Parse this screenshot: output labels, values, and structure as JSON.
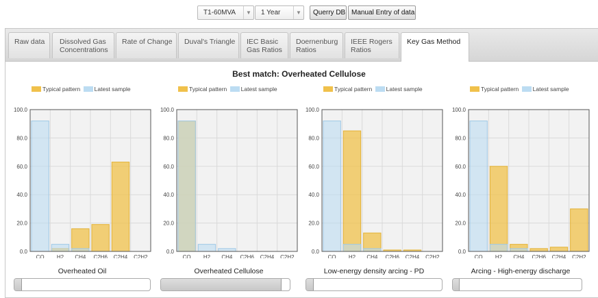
{
  "toolbar": {
    "transformer": {
      "value": "T1-60MVA"
    },
    "period": {
      "value": "1 Year"
    },
    "query_button": "Querry DB",
    "manual_button": "Manual Entry of data"
  },
  "tabs": [
    {
      "label": "Raw data",
      "active": false
    },
    {
      "label": "Dissolved Gas\nConcentrations",
      "active": false
    },
    {
      "label": "Rate of Change",
      "active": false
    },
    {
      "label": "Duval's Triangle",
      "active": false
    },
    {
      "label": "IEC Basic\nGas Ratios",
      "active": false
    },
    {
      "label": "Doernenburg\nRatios",
      "active": false
    },
    {
      "label": "IEEE Rogers\nRatios",
      "active": false
    },
    {
      "label": "Key Gas Method",
      "active": true
    }
  ],
  "best_match": "Best match: Overheated Cellulose",
  "legend": {
    "typical": "Typical pattern",
    "latest": "Latest sample"
  },
  "colors": {
    "typical_fill": "#f0c14b",
    "typical_stroke": "#e3b236",
    "latest_fill": "#bcdcf2",
    "latest_stroke": "#9ec8e6",
    "plot_bg": "#f2f2f2",
    "grid": "#d9d9d9"
  },
  "sliders": [
    {
      "value": 0.05
    },
    {
      "value": 0.93
    },
    {
      "value": 0.05
    },
    {
      "value": 0.05
    }
  ],
  "chart_data": [
    {
      "type": "bar",
      "title": "Overheated Oil",
      "categories": [
        "CO",
        "H2",
        "CH4",
        "C2H6",
        "C2H4",
        "C2H2"
      ],
      "series": [
        {
          "name": "Typical pattern",
          "values": [
            0,
            2,
            16,
            19,
            63,
            0
          ]
        },
        {
          "name": "Latest sample",
          "values": [
            92,
            5,
            2,
            0,
            0,
            0
          ]
        }
      ],
      "ylim": [
        0,
        100
      ],
      "yticks": [
        "0.0",
        "20.0",
        "40.0",
        "60.0",
        "80.0",
        "100.0"
      ],
      "grid": true
    },
    {
      "type": "bar",
      "title": "Overheated Cellulose",
      "categories": [
        "CO",
        "H2",
        "CH4",
        "C2H6",
        "C2H4",
        "C2H2"
      ],
      "series": [
        {
          "name": "Typical pattern",
          "values": [
            92,
            0,
            0,
            0,
            0,
            0
          ]
        },
        {
          "name": "Latest sample",
          "values": [
            92,
            5,
            2,
            0,
            0,
            0
          ]
        }
      ],
      "ylim": [
        0,
        100
      ],
      "yticks": [
        "0.0",
        "20.0",
        "40.0",
        "60.0",
        "80.0",
        "100.0"
      ],
      "grid": true
    },
    {
      "type": "bar",
      "title": "Low-energy density arcing - PD",
      "categories": [
        "CO",
        "H2",
        "CH4",
        "C2H6",
        "C2H4",
        "C2H2"
      ],
      "series": [
        {
          "name": "Typical pattern",
          "values": [
            0,
            85,
            13,
            1,
            1,
            0
          ]
        },
        {
          "name": "Latest sample",
          "values": [
            92,
            5,
            2,
            0,
            0,
            0
          ]
        }
      ],
      "ylim": [
        0,
        100
      ],
      "yticks": [
        "0.0",
        "20.0",
        "40.0",
        "60.0",
        "80.0",
        "100.0"
      ],
      "grid": true
    },
    {
      "type": "bar",
      "title": "Arcing - High-energy discharge",
      "categories": [
        "CO",
        "H2",
        "CH4",
        "C2H6",
        "C2H4",
        "C2H2"
      ],
      "series": [
        {
          "name": "Typical pattern",
          "values": [
            0,
            60,
            5,
            2,
            3,
            30
          ]
        },
        {
          "name": "Latest sample",
          "values": [
            92,
            5,
            2,
            0,
            0,
            0
          ]
        }
      ],
      "ylim": [
        0,
        100
      ],
      "yticks": [
        "0.0",
        "20.0",
        "40.0",
        "60.0",
        "80.0",
        "100.0"
      ],
      "grid": true
    }
  ]
}
